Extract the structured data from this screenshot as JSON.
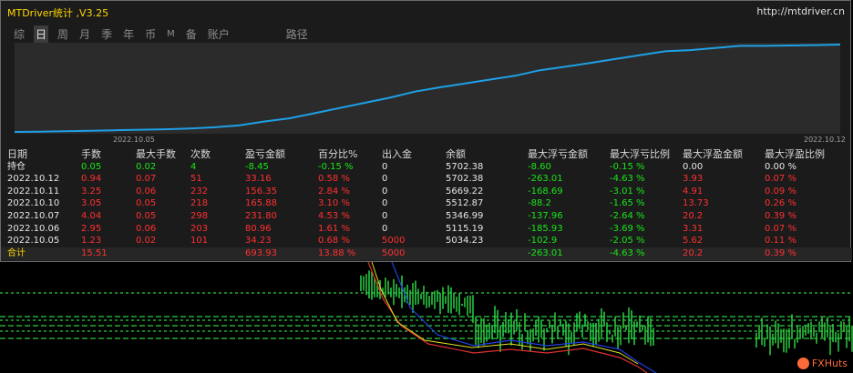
{
  "window": {
    "title": "MTDriver统计 ,V3.25",
    "url": "http://mtdriver.cn"
  },
  "tabs": [
    {
      "label": "综",
      "active": false
    },
    {
      "label": "日",
      "active": true
    },
    {
      "label": "周",
      "active": false
    },
    {
      "label": "月",
      "active": false
    },
    {
      "label": "季",
      "active": false
    },
    {
      "label": "年",
      "active": false
    },
    {
      "label": "币",
      "active": false
    },
    {
      "label": "M",
      "active": false
    },
    {
      "label": "备",
      "active": false
    },
    {
      "label": "账户",
      "active": false
    },
    {
      "label": "路径",
      "active": false
    }
  ],
  "equity_chart": {
    "start_date": "2022.10.05",
    "end_date": "2022.10.12",
    "line_color": "#1ea0e6",
    "curve": [
      5034.23,
      5036,
      5039,
      5043,
      5047,
      5051,
      5055,
      5060,
      5070,
      5085,
      5115.19,
      5140,
      5180,
      5220,
      5260,
      5300,
      5346.99,
      5380,
      5410,
      5440,
      5470,
      5512.87,
      5540,
      5569.22,
      5600,
      5630,
      5660,
      5669.22,
      5685,
      5702.38,
      5702.38,
      5705,
      5708,
      5712
    ]
  },
  "table": {
    "headers": [
      "日期",
      "手数",
      "最大手数",
      "次数",
      "盈亏金额",
      "百分比%",
      "出入金",
      "余额",
      "最大浮亏金额",
      "最大浮亏比例",
      "最大浮盈金额",
      "最大浮盈比例"
    ],
    "rows": [
      {
        "cells": [
          "持仓",
          "0.05",
          "0.02",
          "4",
          "-8.45",
          "-0.15 %",
          "0",
          "5702.38",
          "-8.60",
          "-0.15 %",
          "0.00",
          "0.00 %"
        ],
        "colors": [
          "white",
          "green",
          "green",
          "green",
          "green",
          "green",
          "white",
          "white",
          "green",
          "green",
          "white",
          "white"
        ]
      },
      {
        "cells": [
          "2022.10.12",
          "0.94",
          "0.07",
          "51",
          "33.16",
          "0.58 %",
          "0",
          "5702.38",
          "-263.01",
          "-4.63 %",
          "3.93",
          "0.07 %"
        ],
        "colors": [
          "white",
          "red",
          "red",
          "red",
          "red",
          "red",
          "white",
          "white",
          "green",
          "green",
          "red",
          "red"
        ]
      },
      {
        "cells": [
          "2022.10.11",
          "3.25",
          "0.06",
          "232",
          "156.35",
          "2.84 %",
          "0",
          "5669.22",
          "-168.69",
          "-3.01 %",
          "4.91",
          "0.09 %"
        ],
        "colors": [
          "white",
          "red",
          "red",
          "red",
          "red",
          "red",
          "white",
          "white",
          "green",
          "green",
          "red",
          "red"
        ]
      },
      {
        "cells": [
          "2022.10.10",
          "3.05",
          "0.05",
          "218",
          "165.88",
          "3.10 %",
          "0",
          "5512.87",
          "-88.2",
          "-1.65 %",
          "13.73",
          "0.26 %"
        ],
        "colors": [
          "white",
          "red",
          "red",
          "red",
          "red",
          "red",
          "white",
          "white",
          "green",
          "green",
          "red",
          "red"
        ]
      },
      {
        "cells": [
          "2022.10.07",
          "4.04",
          "0.05",
          "298",
          "231.80",
          "4.53 %",
          "0",
          "5346.99",
          "-137.96",
          "-2.64 %",
          "20.2",
          "0.39 %"
        ],
        "colors": [
          "white",
          "red",
          "red",
          "red",
          "red",
          "red",
          "white",
          "white",
          "green",
          "green",
          "red",
          "red"
        ]
      },
      {
        "cells": [
          "2022.10.06",
          "2.95",
          "0.06",
          "203",
          "80.96",
          "1.61 %",
          "0",
          "5115.19",
          "-185.93",
          "-3.69 %",
          "3.31",
          "0.07 %"
        ],
        "colors": [
          "white",
          "red",
          "red",
          "red",
          "red",
          "red",
          "white",
          "white",
          "green",
          "green",
          "red",
          "red"
        ]
      },
      {
        "cells": [
          "2022.10.05",
          "1.23",
          "0.02",
          "101",
          "34.23",
          "0.68 %",
          "5000",
          "5034.23",
          "-102.9",
          "-2.05 %",
          "5.62",
          "0.11 %"
        ],
        "colors": [
          "white",
          "red",
          "red",
          "red",
          "red",
          "red",
          "red",
          "white",
          "green",
          "green",
          "red",
          "red"
        ]
      }
    ],
    "total": {
      "cells": [
        "合计",
        "15.51",
        "",
        "",
        "693.93",
        "13.88 %",
        "5000",
        "",
        "-263.01",
        "-4.63 %",
        "20.2",
        "0.39 %"
      ],
      "colors": [
        "yellow",
        "red",
        "red",
        "red",
        "red",
        "red",
        "red",
        "white",
        "green",
        "green",
        "red",
        "red"
      ]
    }
  },
  "watermark": "FXHuts"
}
